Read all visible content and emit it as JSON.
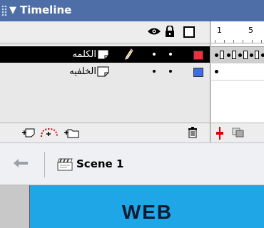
{
  "panel": {
    "title": "Timeline"
  },
  "layers": [
    {
      "name": "الكلمه",
      "selected": true,
      "color": "#e8333d"
    },
    {
      "name": "الخلفيه",
      "selected": false,
      "color": "#3b6fe0"
    }
  ],
  "frame_ruler": {
    "tick_1": "1",
    "tick_5": "5"
  },
  "edit_bar": {
    "scene_label": "Scene 1"
  },
  "stage": {
    "text": "WEB",
    "background": "#1fa6e6"
  }
}
